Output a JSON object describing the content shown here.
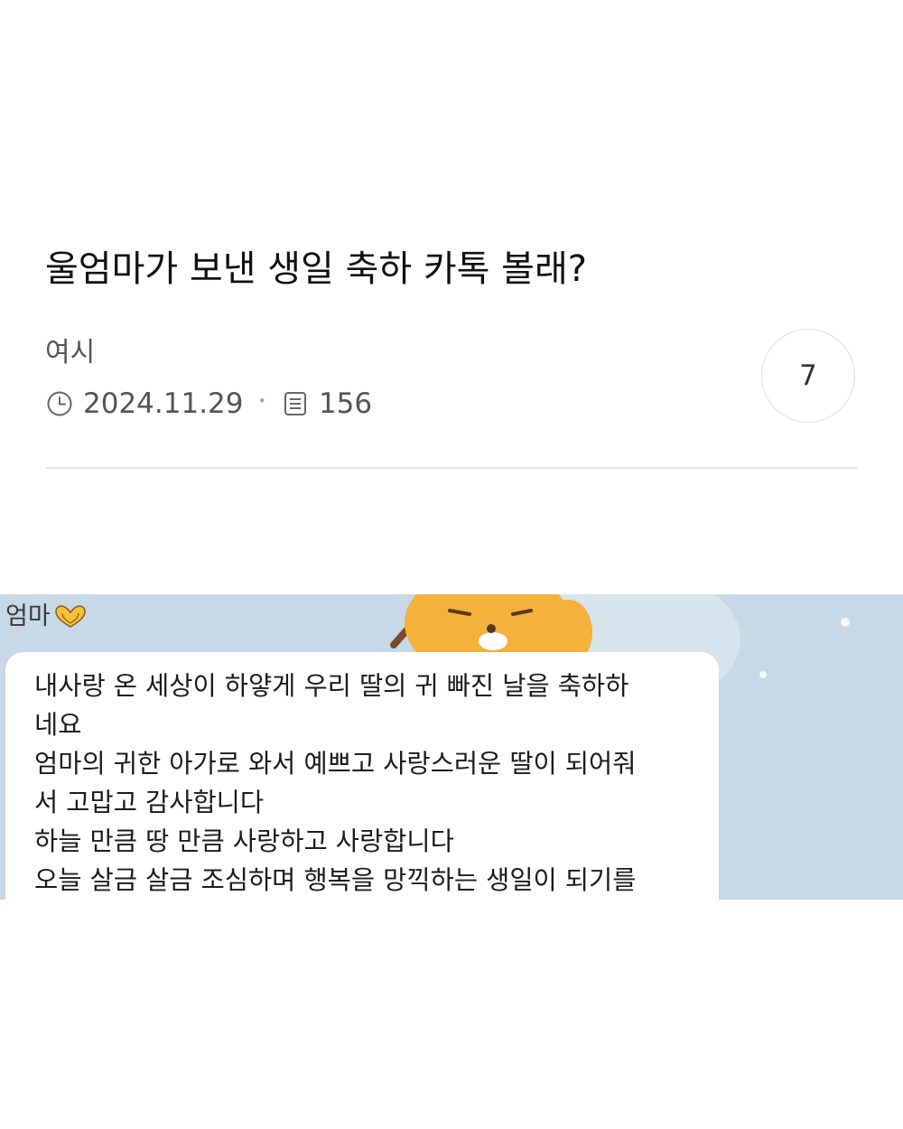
{
  "post": {
    "title": "울엄마가 보낸 생일 축하 카톡 볼래?",
    "author": "여시",
    "date": "2024.11.29",
    "views": "156",
    "comment_count": "7"
  },
  "icons": {
    "date": "clock-icon",
    "views": "document-list-icon",
    "sender_emoji": "heart-hands-icon",
    "sticker": "ryan-character-sticker"
  },
  "chat": {
    "sender": "엄마",
    "message_lines": [
      "내사랑 온 세상이 하얗게 우리 딸의 귀 빠진 날을 축하하",
      "네요",
      "엄마의 귀한 아가로 와서 예쁘고 사랑스러운 딸이 되어줘",
      "서 고맙고 감사합니다",
      "하늘 만큼 땅 만큼 사랑하고 사랑합니다",
      "오늘 살금 살금 조심하며 행복을 망끽하는 생일이 되기를"
    ]
  },
  "colors": {
    "chat_background": "#c7d8e6",
    "bubble": "#ffffff",
    "sticker_character": "#f4b13b"
  }
}
